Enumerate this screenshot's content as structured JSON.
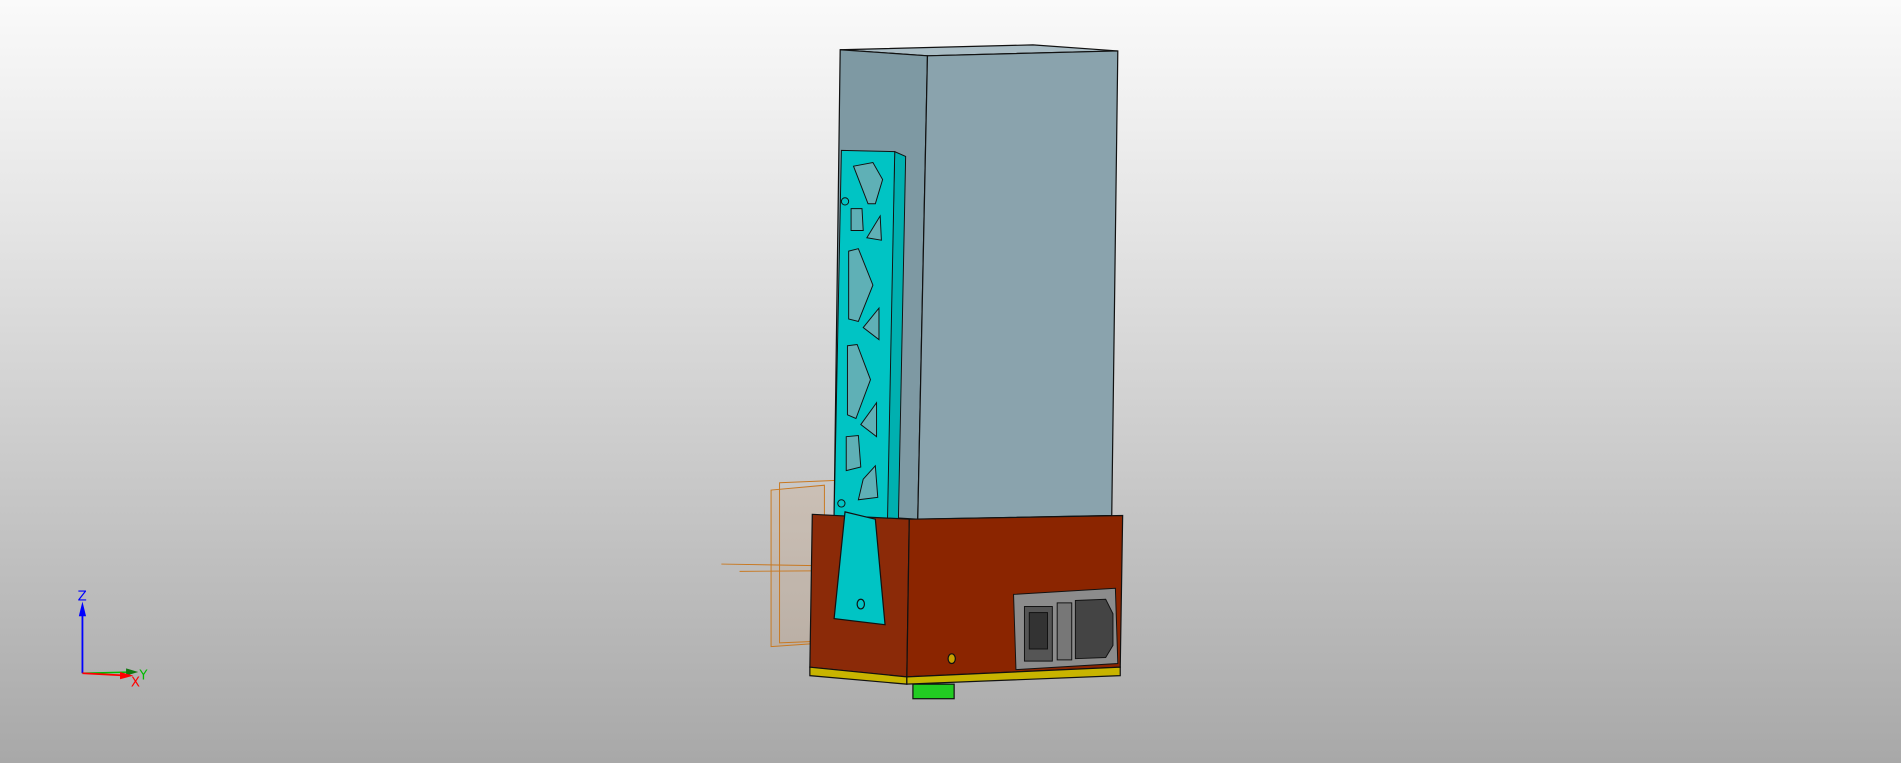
{
  "viewport": {
    "name": "3D CAD viewport"
  },
  "axes": {
    "x_label": "X",
    "y_label": "Y",
    "z_label": "Z"
  },
  "colors": {
    "enclosure": "#8aa3ad",
    "bracket": "#00c0c0",
    "base": "#8b2500",
    "strip": "#c8b400",
    "foot": "#22cc22",
    "module": "#8c8c8c",
    "x_axis": "#ff0000",
    "y_axis": "#00bb00",
    "z_axis": "#0000ff"
  }
}
